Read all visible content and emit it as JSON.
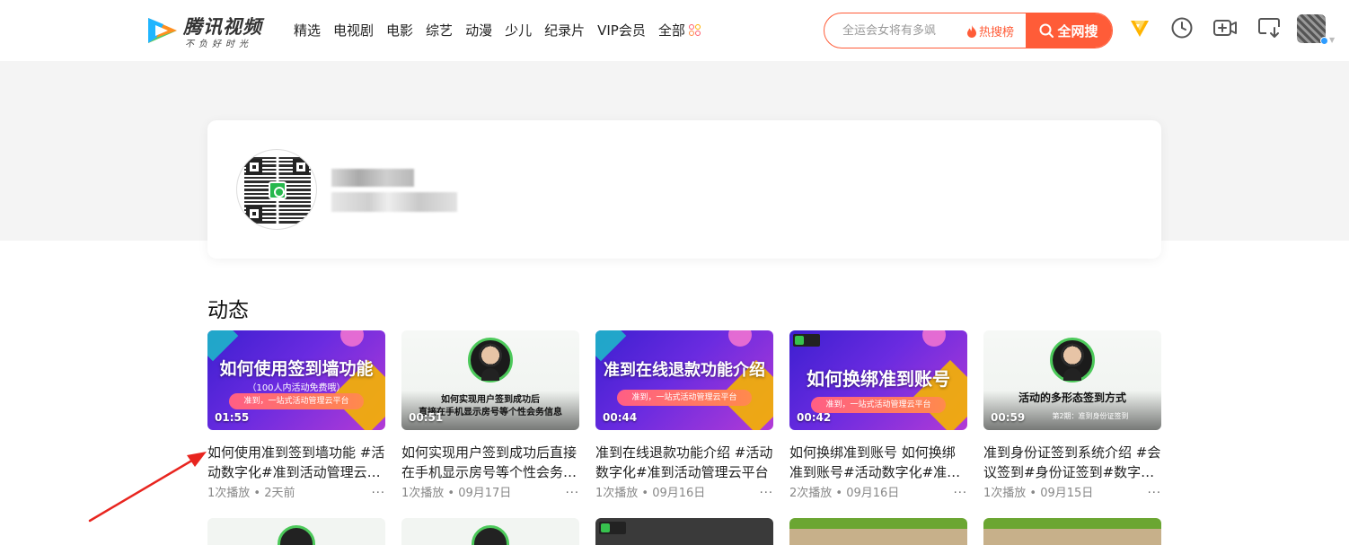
{
  "header": {
    "logo_text": "腾讯视频",
    "logo_slogan": "不负好时光",
    "nav": [
      "精选",
      "电视剧",
      "电影",
      "综艺",
      "动漫",
      "少儿",
      "纪录片",
      "VIP会员",
      "全部"
    ],
    "search": {
      "placeholder": "全运会女将有多飒",
      "hot_label": "热搜榜",
      "button_label": "全网搜"
    },
    "icons": [
      "vip-diamond-icon",
      "history-clock-icon",
      "upload-video-icon",
      "download-icon",
      "user-avatar"
    ],
    "accent_color": "#ff5c38"
  },
  "section": {
    "title": "动态"
  },
  "videos": [
    {
      "thumb_title": "如何使用签到墙功能",
      "thumb_sub": "（100人内活动免费哦）",
      "thumb_pill": "准到，一站式活动管理云平台",
      "duration": "01:55",
      "title": "如何使用准到签到墙功能 #活动数字化#准到活动管理云平台",
      "plays": "1次播放",
      "date": "2天前"
    },
    {
      "thumb_title": "如何实现用户签到成功后",
      "thumb_sub": "直接在手机显示房号等个性会务信息",
      "duration": "00:51",
      "title": "如何实现用户签到成功后直接在手机显示房号等个性会务信息",
      "plays": "1次播放",
      "date": "09月17日"
    },
    {
      "thumb_title": "准到在线退款功能介绍",
      "thumb_pill": "准到，一站式活动管理云平台",
      "duration": "00:44",
      "title": "准到在线退款功能介绍 #活动数字化#准到活动管理云平台",
      "plays": "1次播放",
      "date": "09月16日"
    },
    {
      "thumb_title": "如何换绑准到账号",
      "thumb_pill": "准到，一站式活动管理云平台",
      "duration": "00:42",
      "title": "如何换绑准到账号 如何换绑准到账号#活动数字化#准到活动管理云平台",
      "plays": "2次播放",
      "date": "09月16日"
    },
    {
      "thumb_title": "活动的多形态签到方式",
      "thumb_sub": "第2期：准到身份证签到",
      "duration": "00:59",
      "title": "准到身份证签到系统介绍 #会议签到#身份证签到#数字化活动",
      "plays": "1次播放",
      "date": "09月15日"
    }
  ],
  "meta_separator": " • ",
  "more_label": "···"
}
